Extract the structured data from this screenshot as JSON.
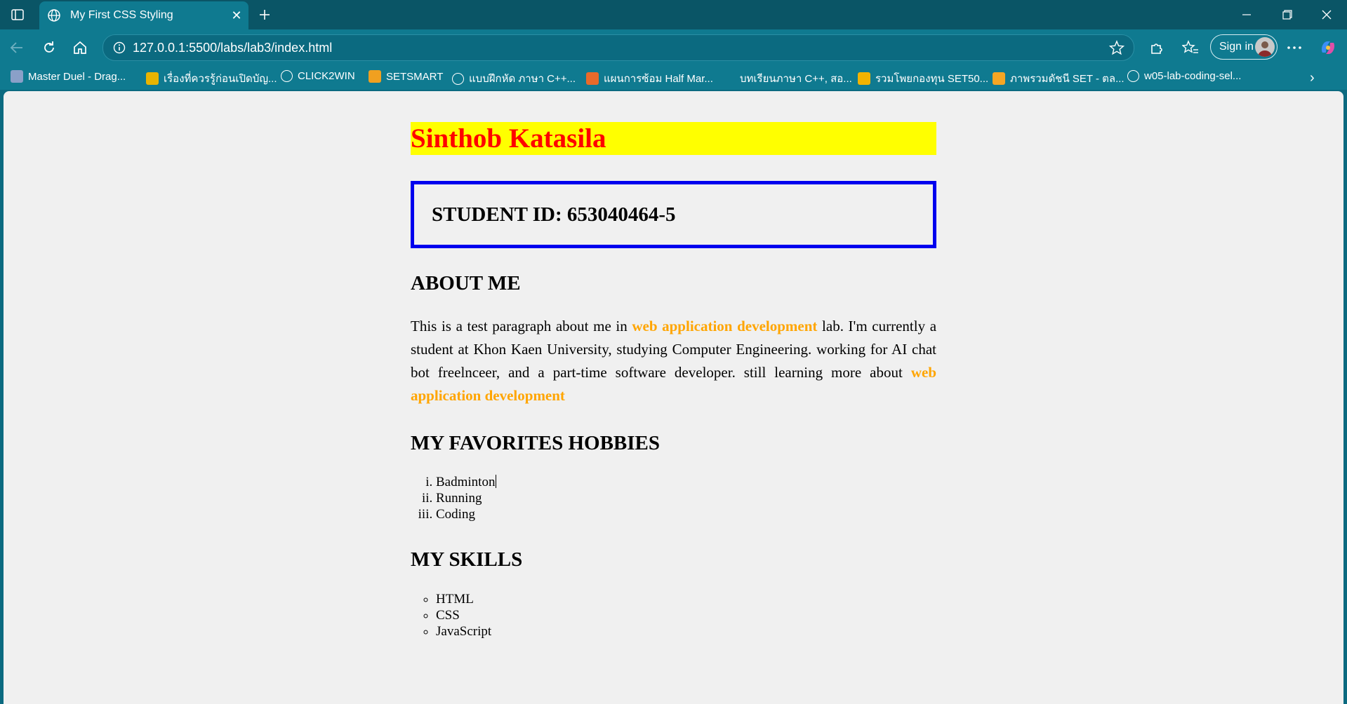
{
  "browser": {
    "tab_title": "My First CSS Styling",
    "url": "127.0.0.1:5500/labs/lab3/index.html",
    "sign_in_label": "Sign in",
    "bookmarks": [
      {
        "label": "Master Duel - Drag...",
        "color": "#8aa0c8"
      },
      {
        "label": "เรื่องที่ควรรู้ก่อนเปิดบัญ...",
        "color": "#e8b400"
      },
      {
        "label": "CLICK2WIN",
        "color": "#ffffff"
      },
      {
        "label": "SETSMART",
        "color": "#f0a020"
      },
      {
        "label": "แบบฝึกหัด ภาษา C++...",
        "color": "#ffffff"
      },
      {
        "label": "แผนการซ้อม Half Mar...",
        "color": "#e86a2a"
      },
      {
        "label": "บทเรียนภาษา C++, สอ...",
        "color": "#0f7a90"
      },
      {
        "label": "รวมโพยกองทุน SET50...",
        "color": "#f2b300"
      },
      {
        "label": "ภาพรวมดัชนี SET - ตล...",
        "color": "#f5a623"
      },
      {
        "label": "w05-lab-coding-sel...",
        "color": "#ffffff"
      }
    ]
  },
  "page": {
    "name": "Sinthob Katasila",
    "student_id": "STUDENT ID: 653040464-5",
    "about_title": "ABOUT ME",
    "about": {
      "p1": "This is a test paragraph about me in ",
      "hl1": "web application development",
      "p2": " lab. I'm currently a student at Khon Kaen University, studying Computer Engineering. working for AI chat bot freelnceer, and a part-time software developer. still learning more about ",
      "hl2": "web application development"
    },
    "hobbies_title": "MY FAVORITES HOBBIES",
    "hobbies": [
      "Badminton",
      "Running",
      "Coding"
    ],
    "skills_title": "MY SKILLS",
    "skills": [
      "HTML",
      "CSS",
      "JavaScript"
    ]
  }
}
